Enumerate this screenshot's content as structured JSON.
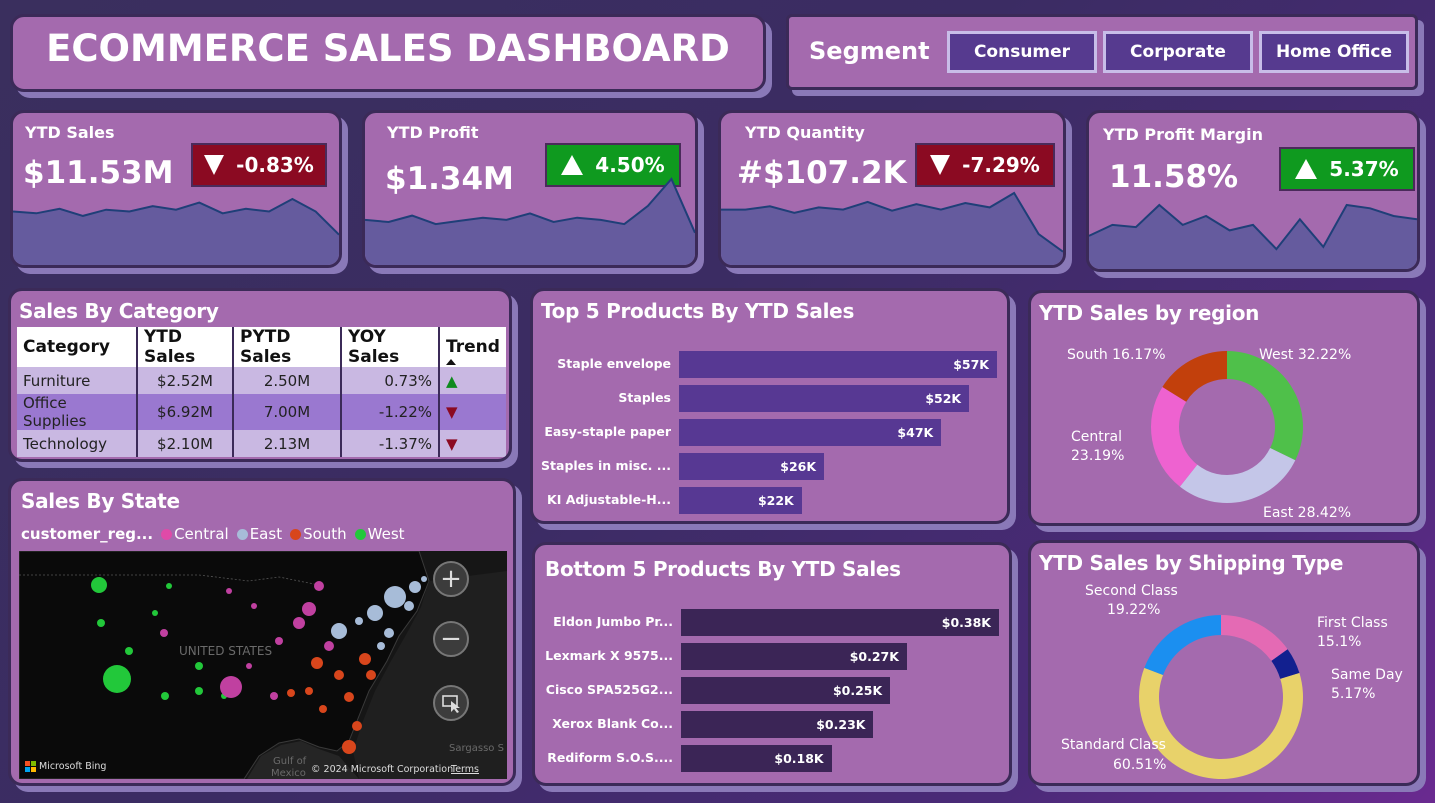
{
  "header": {
    "title": "ECOMMERCE SALES DASHBOARD"
  },
  "segment": {
    "label": "Segment",
    "options": [
      "Consumer",
      "Corporate",
      "Home Office"
    ]
  },
  "kpis": [
    {
      "label": "YTD Sales",
      "value": "$11.53M",
      "change": "-0.83%",
      "direction": "down",
      "spark": [
        60,
        58,
        63,
        55,
        62,
        60,
        66,
        62,
        70,
        58,
        63,
        60,
        74,
        60,
        34
      ]
    },
    {
      "label": "YTD Profit",
      "value": "$1.34M",
      "change": "4.50%",
      "direction": "up",
      "spark": [
        42,
        40,
        46,
        38,
        41,
        44,
        42,
        48,
        40,
        44,
        42,
        38,
        55,
        80,
        30
      ]
    },
    {
      "label": "YTD Quantity",
      "value": "#$107.2K",
      "change": "-7.29%",
      "direction": "down",
      "spark": [
        50,
        50,
        53,
        47,
        52,
        50,
        57,
        49,
        55,
        50,
        56,
        52,
        65,
        28,
        12
      ]
    },
    {
      "label": "YTD Profit Margin",
      "value": "11.58%",
      "change": "5.37%",
      "direction": "up",
      "spark": [
        30,
        40,
        38,
        58,
        40,
        48,
        35,
        40,
        18,
        45,
        20,
        58,
        55,
        48,
        45
      ]
    }
  ],
  "category_table": {
    "title": "Sales By Category",
    "columns": [
      "Category",
      "YTD Sales",
      "PYTD Sales",
      "YOY Sales",
      "Trend"
    ],
    "rows": [
      {
        "category": "Furniture",
        "ytd": "$2.52M",
        "pytd": "2.50M",
        "yoy": "0.73%",
        "trend": "up"
      },
      {
        "category": "Office Supplies",
        "ytd": "$6.92M",
        "pytd": "7.00M",
        "yoy": "-1.22%",
        "trend": "down"
      },
      {
        "category": "Technology",
        "ytd": "$2.10M",
        "pytd": "2.13M",
        "yoy": "-1.37%",
        "trend": "down"
      }
    ]
  },
  "state_map": {
    "title": "Sales By State",
    "legend_title": "customer_reg...",
    "legend": [
      {
        "name": "Central",
        "color": "#e04aa8"
      },
      {
        "name": "East",
        "color": "#a7bcd8"
      },
      {
        "name": "South",
        "color": "#d8461c"
      },
      {
        "name": "West",
        "color": "#22c83a"
      }
    ],
    "country_label": "UNITED STATES",
    "gulf_label": "Gulf of\nMexico",
    "sargasso_label": "Sargasso S",
    "bing": "Microsoft Bing",
    "copyright": "© 2024 Microsoft Corporation",
    "terms": "Terms",
    "zoom_in": "+",
    "zoom_out": "−"
  },
  "chart_data": [
    {
      "type": "bar",
      "orientation": "horizontal",
      "title": "Top 5 Products By YTD Sales",
      "categories": [
        "Staple envelope",
        "Staples",
        "Easy-staple paper",
        "Staples in misc. ...",
        "KI Adjustable-H..."
      ],
      "values": [
        57,
        52,
        47,
        26,
        22
      ],
      "labels": [
        "$57K",
        "$52K",
        "$47K",
        "$26K",
        "$22K"
      ],
      "unit": "K",
      "color": "#573893"
    },
    {
      "type": "bar",
      "orientation": "horizontal",
      "title": "Bottom 5 Products By YTD Sales",
      "categories": [
        "Eldon Jumbo Pr...",
        "Lexmark X 9575...",
        "Cisco SPA525G2...",
        "Xerox Blank Co...",
        "Rediform S.O.S...."
      ],
      "values": [
        0.38,
        0.27,
        0.25,
        0.23,
        0.18
      ],
      "labels": [
        "$0.38K",
        "$0.27K",
        "$0.25K",
        "$0.23K",
        "$0.18K"
      ],
      "unit": "K",
      "color": "#3b2556"
    },
    {
      "type": "pie",
      "donut": true,
      "title": "YTD Sales by region",
      "slices": [
        {
          "name": "West",
          "value": 32.22,
          "label": "West 32.22%",
          "color": "#4fc04a"
        },
        {
          "name": "East",
          "value": 28.42,
          "label": "East 28.42%",
          "color": "#c4c6e8"
        },
        {
          "name": "Central",
          "value": 23.19,
          "label_name": "Central",
          "label_value": "23.19%",
          "color": "#ee62d0"
        },
        {
          "name": "South",
          "value": 16.17,
          "label": "South 16.17%",
          "color": "#c2400c"
        }
      ]
    },
    {
      "type": "pie",
      "donut": true,
      "title": "YTD Sales by Shipping Type",
      "slices": [
        {
          "name": "First Class",
          "value": 15.1,
          "label_name": "First Class",
          "label_value": "15.1%",
          "color": "#e46ab4"
        },
        {
          "name": "Same Day",
          "value": 5.17,
          "label_name": "Same Day",
          "label_value": "5.17%",
          "color": "#12208f"
        },
        {
          "name": "Standard Class",
          "value": 60.51,
          "label_name": "Standard Class",
          "label_value": "60.51%",
          "color": "#e8d26a"
        },
        {
          "name": "Second Class",
          "value": 19.22,
          "label_name": "Second Class",
          "label_value": "19.22%",
          "color": "#1b8ff0"
        }
      ]
    }
  ]
}
